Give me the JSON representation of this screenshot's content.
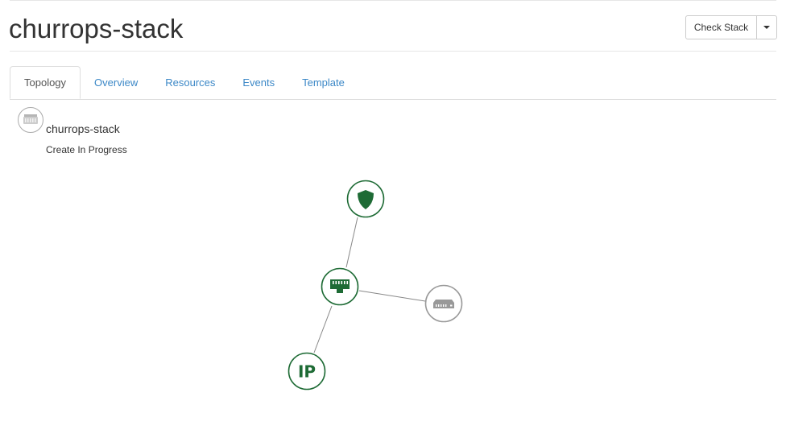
{
  "header": {
    "title": "churrops-stack",
    "check_stack_label": "Check Stack"
  },
  "tabs": [
    {
      "label": "Topology",
      "active": true
    },
    {
      "label": "Overview",
      "active": false
    },
    {
      "label": "Resources",
      "active": false
    },
    {
      "label": "Events",
      "active": false
    },
    {
      "label": "Template",
      "active": false
    }
  ],
  "stack": {
    "name": "churrops-stack",
    "status": "Create In Progress",
    "icon": "stack-server-icon"
  },
  "topology": {
    "colors": {
      "complete": "#1e6b35",
      "in_progress": "#999999",
      "link": "#888888"
    },
    "nodes": [
      {
        "id": "security-group",
        "icon": "shield-icon",
        "status": "complete"
      },
      {
        "id": "port",
        "icon": "network-port-icon",
        "status": "complete"
      },
      {
        "id": "server",
        "icon": "server-icon",
        "status": "in_progress"
      },
      {
        "id": "floating-ip",
        "icon": "ip-icon",
        "label": "IP",
        "status": "complete"
      }
    ],
    "links": [
      {
        "from": "security-group",
        "to": "port"
      },
      {
        "from": "port",
        "to": "server"
      },
      {
        "from": "port",
        "to": "floating-ip"
      }
    ]
  }
}
